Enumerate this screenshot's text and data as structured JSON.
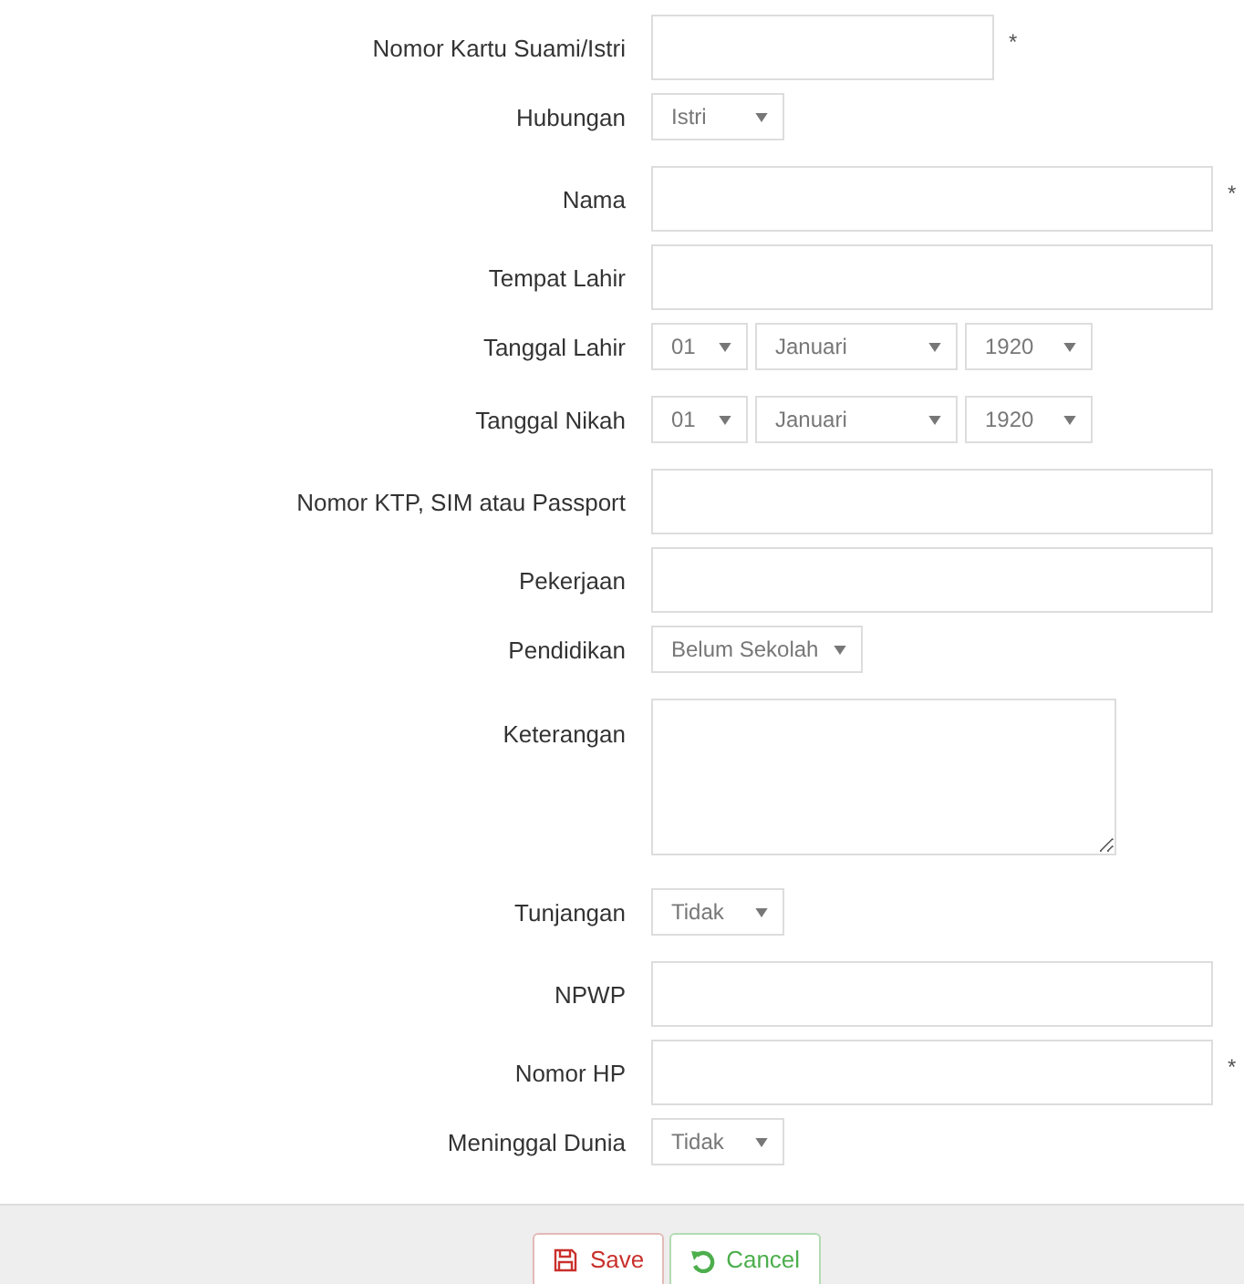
{
  "fields": [
    {
      "label": "Nomor Kartu Suami/Istri",
      "kind": "text",
      "required_mark": "*"
    },
    {
      "label": "Hubungan",
      "kind": "select",
      "value": "Istri"
    },
    {
      "label": "Nama",
      "kind": "text",
      "required_mark": "*"
    },
    {
      "label": "Tempat Lahir",
      "kind": "text"
    },
    {
      "label": "Tanggal Lahir",
      "kind": "date",
      "day": "01",
      "month": "Januari",
      "year": "1920"
    },
    {
      "label": "Tanggal Nikah",
      "kind": "date",
      "day": "01",
      "month": "Januari",
      "year": "1920"
    },
    {
      "label": "Nomor KTP, SIM atau Passport",
      "kind": "text"
    },
    {
      "label": "Pekerjaan",
      "kind": "text"
    },
    {
      "label": "Pendidikan",
      "kind": "select",
      "value": "Belum Sekolah"
    },
    {
      "label": "Keterangan",
      "kind": "textarea"
    },
    {
      "label": "Tunjangan",
      "kind": "select",
      "value": "Tidak"
    },
    {
      "label": "NPWP",
      "kind": "text"
    },
    {
      "label": "Nomor HP",
      "kind": "text",
      "required_mark": "*"
    },
    {
      "label": "Meninggal Dunia",
      "kind": "select",
      "value": "Tidak"
    }
  ],
  "buttons": [
    {
      "label": "Save",
      "kind": "save"
    },
    {
      "label": "Cancel",
      "kind": "cancel"
    }
  ]
}
